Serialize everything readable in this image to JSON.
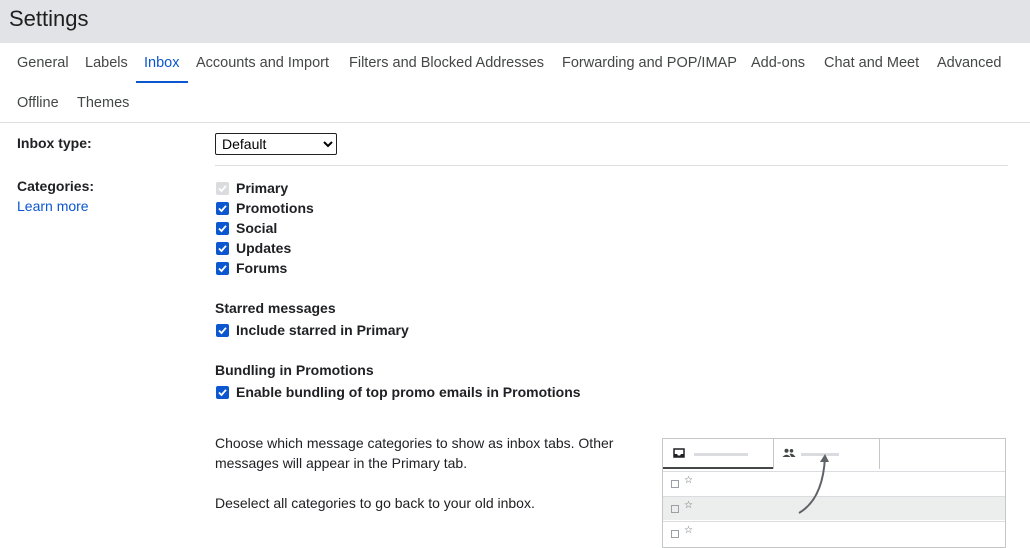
{
  "header": {
    "title": "Settings"
  },
  "tabs": [
    {
      "label": "General",
      "active": false
    },
    {
      "label": "Labels",
      "active": false
    },
    {
      "label": "Inbox",
      "active": true
    },
    {
      "label": "Accounts and Import",
      "active": false
    },
    {
      "label": "Filters and Blocked Addresses",
      "active": false
    },
    {
      "label": "Forwarding and POP/IMAP",
      "active": false
    },
    {
      "label": "Add-ons",
      "active": false
    },
    {
      "label": "Chat and Meet",
      "active": false
    },
    {
      "label": "Advanced",
      "active": false
    },
    {
      "label": "Offline",
      "active": false
    },
    {
      "label": "Themes",
      "active": false
    }
  ],
  "inbox_type": {
    "label": "Inbox type:",
    "selected": "Default",
    "options": [
      "Default"
    ]
  },
  "categories": {
    "label": "Categories:",
    "learn_more": "Learn more",
    "items": [
      {
        "label": "Primary",
        "checked": true,
        "disabled": true
      },
      {
        "label": "Promotions",
        "checked": true,
        "disabled": false
      },
      {
        "label": "Social",
        "checked": true,
        "disabled": false
      },
      {
        "label": "Updates",
        "checked": true,
        "disabled": false
      },
      {
        "label": "Forums",
        "checked": true,
        "disabled": false
      }
    ]
  },
  "starred": {
    "title": "Starred messages",
    "option": "Include starred in Primary",
    "checked": true
  },
  "bundling": {
    "title": "Bundling in Promotions",
    "option": "Enable bundling of top promo emails in Promotions",
    "checked": true
  },
  "description": {
    "line1": "Choose which message categories to show as inbox tabs. Other messages will appear in the Primary tab.",
    "line2": "Deselect all categories to go back to your old inbox."
  },
  "icons": {
    "check": "check-icon",
    "inbox": "inbox-icon",
    "people": "people-icon",
    "star": "☆",
    "arrow": "curved-arrow-icon"
  },
  "colors": {
    "accent": "#0b57d0",
    "header_bg": "#e2e3e6",
    "disabled_checkbox": "#dadce0"
  }
}
